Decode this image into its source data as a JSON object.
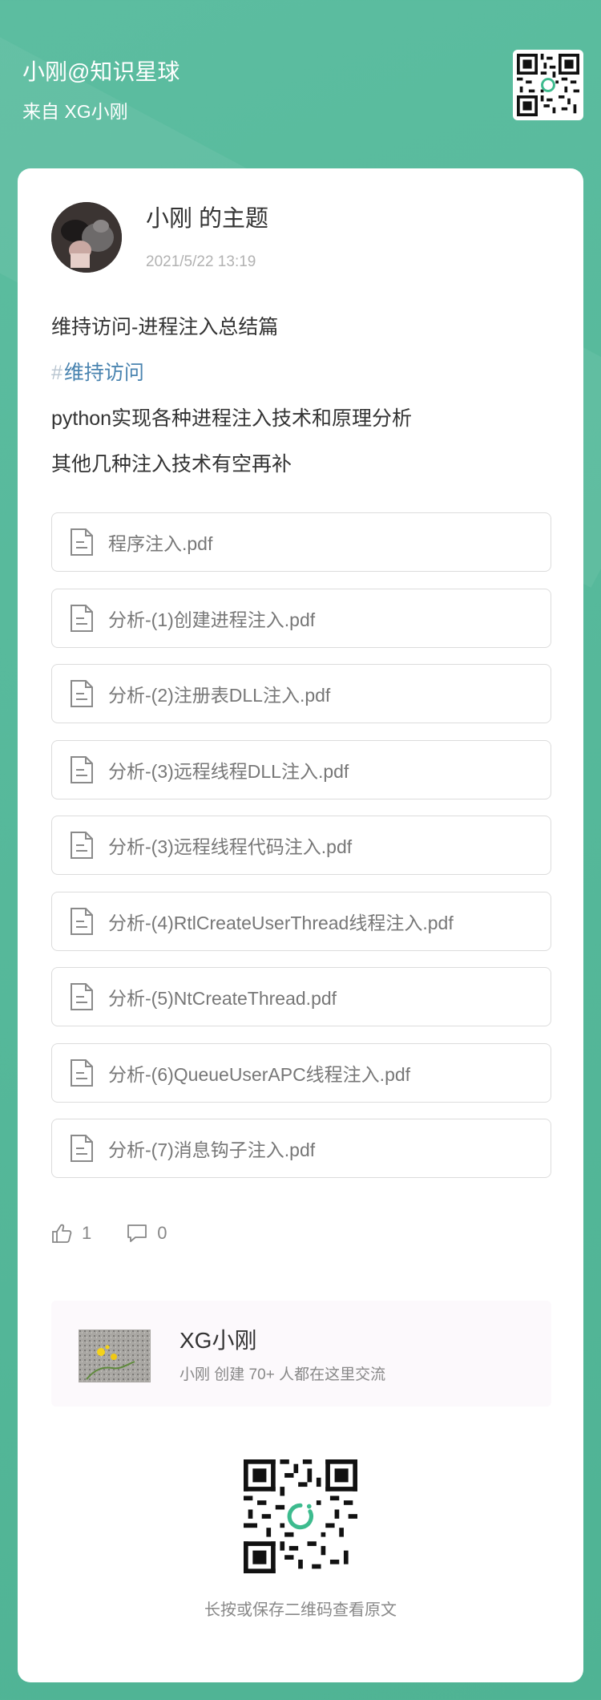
{
  "header": {
    "planet_title": "小刚@知识星球",
    "source": "来自 XG小刚"
  },
  "post": {
    "author_title": "小刚 的主题",
    "date": "2021/5/22 13:19",
    "lines": [
      "维持访问-进程注入总结篇",
      "维持访问",
      "python实现各种进程注入技术和原理分析",
      "其他几种注入技术有空再补"
    ],
    "tag_hash": "#"
  },
  "files": [
    "程序注入.pdf",
    "分析-(1)创建进程注入.pdf",
    "分析-(2)注册表DLL注入.pdf",
    "分析-(3)远程线程DLL注入.pdf",
    "分析-(3)远程线程代码注入.pdf",
    "分析-(4)RtlCreateUserThread线程注入.pdf",
    "分析-(5)NtCreateThread.pdf",
    "分析-(6)QueueUserAPC线程注入.pdf",
    "分析-(7)消息钩子注入.pdf"
  ],
  "actions": {
    "likes": "1",
    "comments": "0"
  },
  "planet": {
    "name": "XG小刚",
    "desc": "小刚 创建 70+ 人都在这里交流"
  },
  "footer": {
    "hint": "长按或保存二维码查看原文"
  },
  "colors": {
    "background": "#54b796",
    "tag": "#4a84b0",
    "qr_accent": "#3dbb8e"
  },
  "icons": [
    "qr-code-icon",
    "document-icon",
    "thumbs-up-icon",
    "comment-icon"
  ]
}
